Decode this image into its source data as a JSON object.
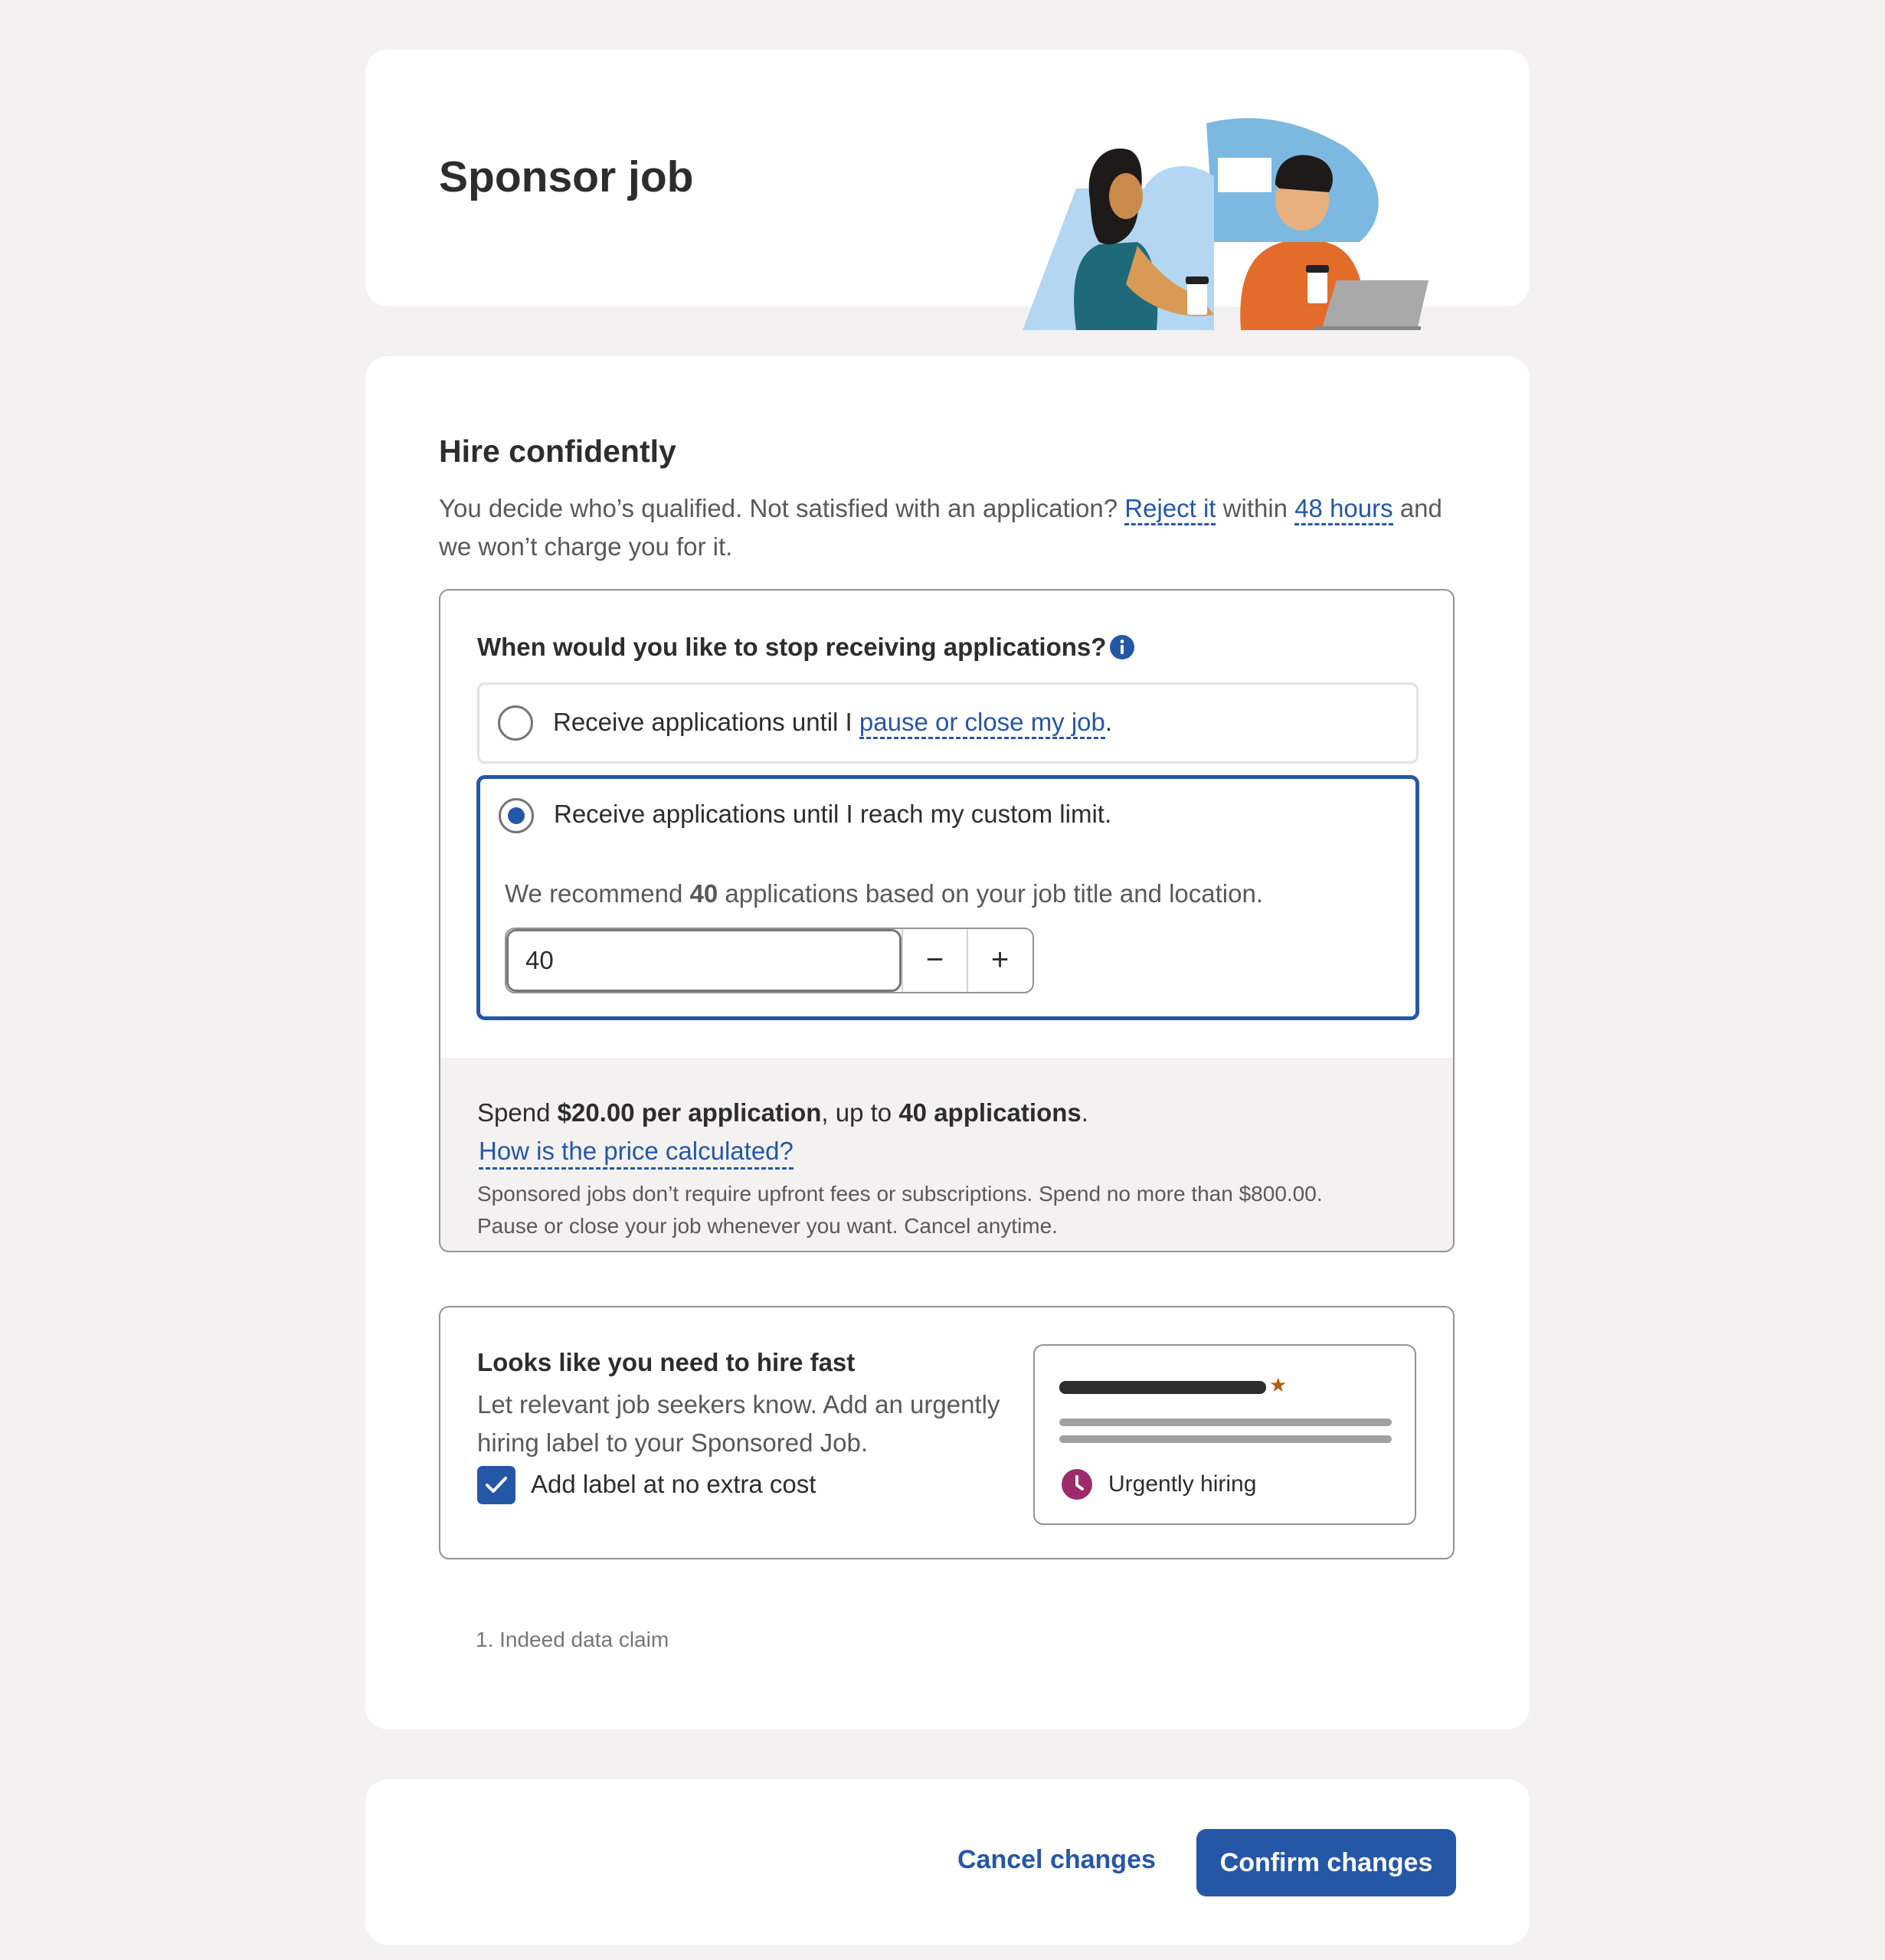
{
  "header": {
    "title": "Sponsor job"
  },
  "hire": {
    "title": "Hire confidently",
    "desc_part1": "You decide who’s qualified. Not satisfied with an application?",
    "reject_link": "Reject it",
    "desc_part2": "within",
    "hours_link": "48 hours",
    "desc_part3": "and we won’t charge you for it."
  },
  "schedule": {
    "question": "When would you like to stop receiving applications?",
    "option_close_prefix": "Receive applications until I",
    "option_close_link": "pause or close my job",
    "option_close_suffix": ".",
    "option_custom_label": "Receive applications until I reach my custom limit.",
    "recommend_prefix": "We recommend",
    "recommend_value": "40",
    "recommend_suffix": "applications based on your job title and location.",
    "limit_value": "40",
    "decrement_symbol": "−",
    "increment_symbol": "+"
  },
  "pricing": {
    "spend_prefix": "Spend",
    "per_application": "$20.00 per application",
    "up_to": ", up to",
    "max_applications": "40 applications",
    "period": ".",
    "link": "How is the price calculated?",
    "note_line1": "Sponsored jobs don’t require upfront fees or subscriptions. Spend no more than $800.00.",
    "note_line2": "Pause or close your job whenever you want. Cancel anytime."
  },
  "urgent": {
    "title": "Looks like you need to hire fast",
    "desc": "Let relevant job seekers know. Add an urgently hiring label to your Sponsored Job.",
    "checkbox_label": "Add label at no extra cost",
    "checkbox_checked": true,
    "preview_label": "Urgently hiring"
  },
  "footnote": "1. Indeed data claim",
  "footer": {
    "cancel_label": "Cancel changes",
    "confirm_label": "Confirm changes"
  },
  "colors": {
    "accent": "#2557a7",
    "background": "#f3f2f1",
    "urgent_icon": "#9d2b6b",
    "star": "#b65e11"
  },
  "icons": {
    "info": "info-icon",
    "checkmark": "checkmark-icon",
    "clock": "clock-icon",
    "star": "star-icon"
  }
}
